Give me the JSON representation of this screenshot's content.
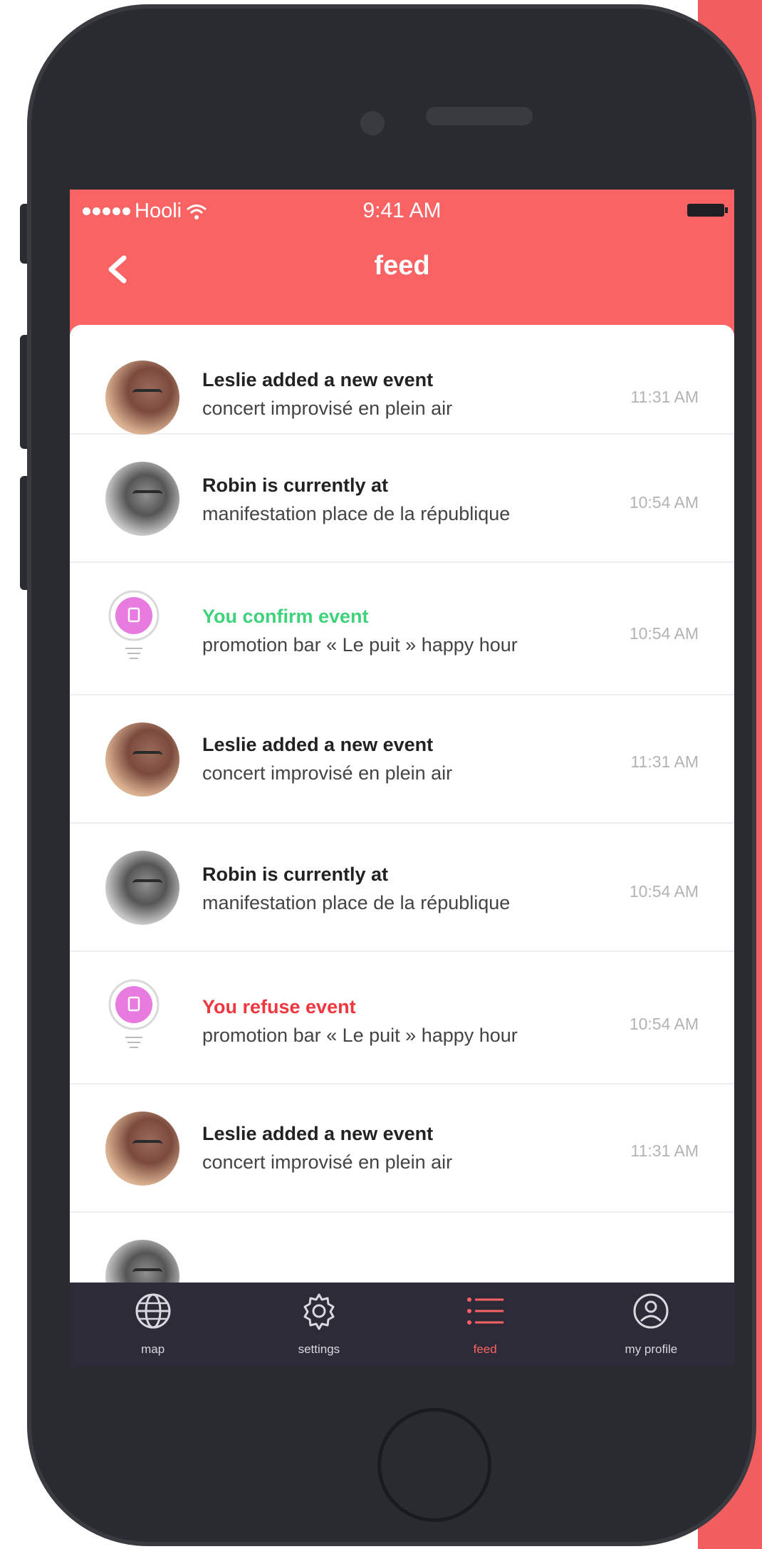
{
  "colors": {
    "accent": "#f96364",
    "confirm": "#3ed27a",
    "refuse": "#f0363f",
    "tabbar": "#2c2b37"
  },
  "statusbar": {
    "carrier": "Hooli",
    "time": "9:41 AM"
  },
  "navbar": {
    "title": "feed"
  },
  "feed": [
    {
      "avatar": "leslie-avatar",
      "title": "Leslie added a new event",
      "subtitle": "concert improvisé en plein air",
      "time": "11:31 AM"
    },
    {
      "avatar": "robin-avatar",
      "title": "Robin is currently at",
      "subtitle": "manifestation place de la république",
      "time": "10:54 AM"
    },
    {
      "avatar": "pin-icon",
      "title": "You confirm event",
      "subtitle": "promotion bar « Le puit » happy hour",
      "time": "10:54 AM"
    },
    {
      "avatar": "leslie-avatar",
      "title": "Leslie added a new event",
      "subtitle": "concert improvisé en plein air",
      "time": "11:31 AM"
    },
    {
      "avatar": "robin-avatar",
      "title": "Robin is currently at",
      "subtitle": "manifestation place de la république",
      "time": "10:54 AM"
    },
    {
      "avatar": "pin-icon",
      "title": "You refuse event",
      "subtitle": "promotion bar « Le puit » happy hour",
      "time": "10:54 AM"
    },
    {
      "avatar": "leslie-avatar",
      "title": "Leslie added a new event",
      "subtitle": "concert improvisé en plein air",
      "time": "11:31 AM"
    }
  ],
  "tabbar": {
    "items": [
      {
        "label": "map",
        "icon": "globe-icon"
      },
      {
        "label": "settings",
        "icon": "gear-icon"
      },
      {
        "label": "feed",
        "icon": "list-icon",
        "active": true
      },
      {
        "label": "my profile",
        "icon": "user-icon"
      }
    ]
  }
}
